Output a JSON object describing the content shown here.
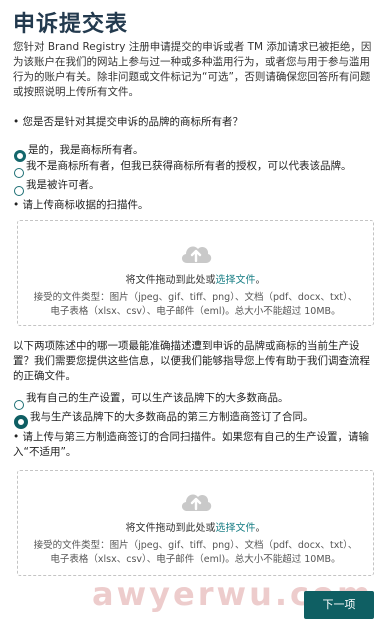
{
  "header": {
    "title": "申诉提交表"
  },
  "intro": "您针对 Brand Registry 注册申请提交的申诉或者 TM 添加请求已被拒绝，因为该账户在我们的网站上参与过一种或多种滥用行为，或者您与用于参与滥用行为的账户有关。除非问题或文件标记为“可选”，否则请确保您回答所有问题或按照说明上传所有文件。",
  "question1": {
    "label": "• 您是否是针对其提交申诉的品牌的商标所有者？",
    "options": [
      "是的，我是商标所有者。",
      "我不是商标所有者，但我已获得商标所有者的授权，可以代表该品牌。",
      "我是被许可者。"
    ]
  },
  "upload1": {
    "label": "• 请上传商标收据的扫描件。",
    "drag_text": "将文件拖动到此处或",
    "select_link": "选择文件",
    "end": "。",
    "types_line1": "接受的文件类型：图片（jpeg、gif、tiff、png）、文档（pdf、docx、txt）、",
    "types_line2": "电子表格（xlsx、csv）、电子邮件（eml)。总大小不能超过 10MB。"
  },
  "question2": {
    "label": "以下两项陈述中的哪一项最能准确描述遭到申诉的品牌或商标的当前生产设置？我们需要您提供这些信息，以便我们能够指导您上传有助于我们调查流程的正确文件。",
    "options": [
      "我有自己的生产设置，可以生产该品牌下的大多数商品。",
      "我与生产该品牌下的大多数商品的第三方制造商签订了合同。"
    ]
  },
  "upload2": {
    "label": "• 请上传与第三方制造商签订的合同扫描件。如果您有自己的生产设置，请输入“不适用”。",
    "drag_text": "将文件拖动到此处或",
    "select_link": "选择文件",
    "end": "。",
    "types_line1": "接受的文件类型：图片（jpeg、gif、tiff、png）、文档（pdf、docx、txt）、",
    "types_line2": "电子表格（xlsx、csv）、电子邮件（eml)。总大小不能超过 10MB。"
  },
  "footer": {
    "next_label": "下一项"
  },
  "watermark": "awyerwu.com",
  "colors": {
    "accent": "#0f5f63",
    "link": "#1a7f86",
    "cloud": "#c9c9c9"
  },
  "icons": {
    "upload": "cloud-upload-icon"
  }
}
